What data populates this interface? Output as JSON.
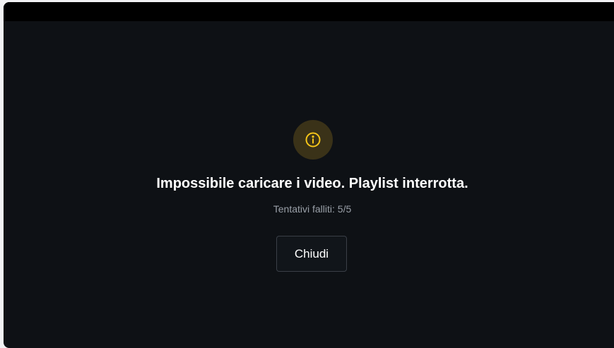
{
  "dialog": {
    "icon": "info-icon",
    "title": "Impossibile caricare i video. Playlist interrotta.",
    "subtitle": "Tentativi falliti: 5/5",
    "close_label": "Chiudi"
  },
  "colors": {
    "background": "#0e1115",
    "titlebar": "#000000",
    "icon_accent": "#f5c518",
    "icon_circle": "#3a3218"
  }
}
